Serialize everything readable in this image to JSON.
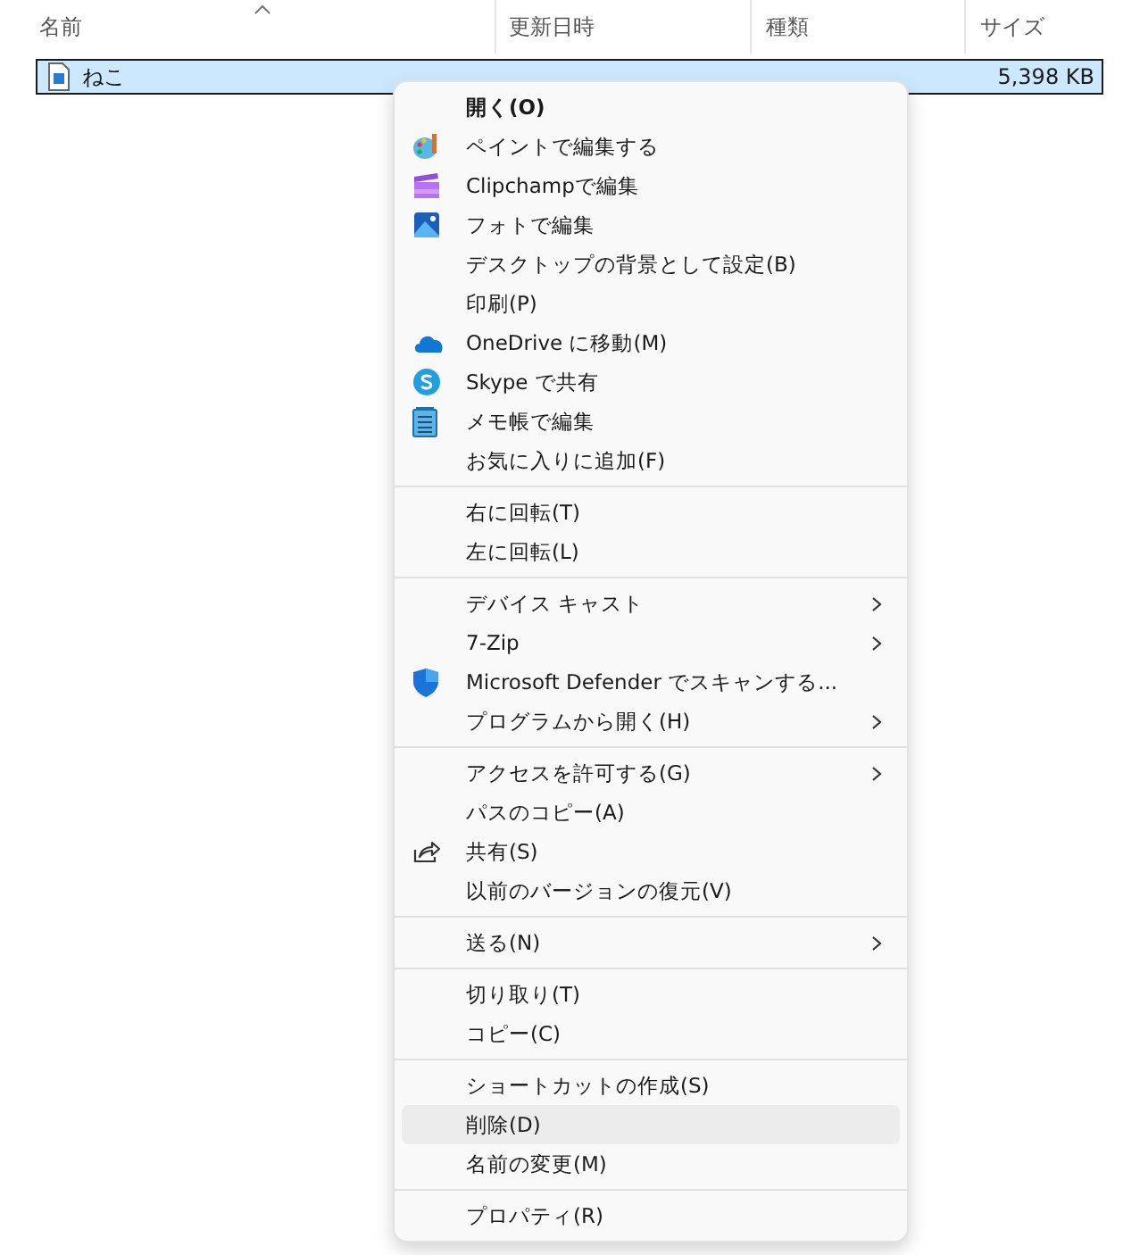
{
  "columns": [
    {
      "label": "名前",
      "sorted": true
    },
    {
      "label": "更新日時",
      "sorted": false
    },
    {
      "label": "種類",
      "sorted": false
    },
    {
      "label": "サイズ",
      "sorted": false
    }
  ],
  "rows": [
    {
      "name": "ねこ",
      "size": "5,398 KB",
      "selected": true
    }
  ],
  "context_menu": {
    "groups": [
      [
        {
          "label": "開く(O)",
          "default": true,
          "submenu": false,
          "selected": false
        },
        {
          "label": "ペイントで編集する",
          "default": false,
          "submenu": false,
          "selected": false
        },
        {
          "label": "Clipchampで編集",
          "default": false,
          "submenu": false,
          "selected": false
        },
        {
          "label": "フォトで編集",
          "default": false,
          "submenu": false,
          "selected": false
        },
        {
          "label": "デスクトップの背景として設定(B)",
          "default": false,
          "submenu": false,
          "selected": false
        },
        {
          "label": "印刷(P)",
          "default": false,
          "submenu": false,
          "selected": false
        },
        {
          "label": "OneDrive に移動(M)",
          "default": false,
          "submenu": false,
          "selected": false
        },
        {
          "label": "Skype で共有",
          "default": false,
          "submenu": false,
          "selected": false
        },
        {
          "label": "メモ帳で編集",
          "default": false,
          "submenu": false,
          "selected": false
        },
        {
          "label": "お気に入りに追加(F)",
          "default": false,
          "submenu": false,
          "selected": false
        }
      ],
      [
        {
          "label": "右に回転(T)",
          "default": false,
          "submenu": false,
          "selected": false
        },
        {
          "label": "左に回転(L)",
          "default": false,
          "submenu": false,
          "selected": false
        }
      ],
      [
        {
          "label": "デバイス キャスト",
          "default": false,
          "submenu": true,
          "selected": false
        },
        {
          "label": "7-Zip",
          "default": false,
          "submenu": true,
          "selected": false
        },
        {
          "label": "Microsoft Defender でスキャンする...",
          "default": false,
          "submenu": false,
          "selected": false
        },
        {
          "label": "プログラムから開く(H)",
          "default": false,
          "submenu": true,
          "selected": false
        }
      ],
      [
        {
          "label": "アクセスを許可する(G)",
          "default": false,
          "submenu": true,
          "selected": false
        },
        {
          "label": "パスのコピー(A)",
          "default": false,
          "submenu": false,
          "selected": false
        },
        {
          "label": "共有(S)",
          "default": false,
          "submenu": false,
          "selected": false
        },
        {
          "label": "以前のバージョンの復元(V)",
          "default": false,
          "submenu": false,
          "selected": false
        }
      ],
      [
        {
          "label": "送る(N)",
          "default": false,
          "submenu": true,
          "selected": false
        }
      ],
      [
        {
          "label": "切り取り(T)",
          "default": false,
          "submenu": false,
          "selected": false
        },
        {
          "label": "コピー(C)",
          "default": false,
          "submenu": false,
          "selected": false
        }
      ],
      [
        {
          "label": "ショートカットの作成(S)",
          "default": false,
          "submenu": false,
          "selected": false
        },
        {
          "label": "削除(D)",
          "default": false,
          "submenu": false,
          "selected": true
        },
        {
          "label": "名前の変更(M)",
          "default": false,
          "submenu": false,
          "selected": false
        }
      ],
      [
        {
          "label": "プロパティ(R)",
          "default": false,
          "submenu": false,
          "selected": false
        }
      ]
    ]
  }
}
